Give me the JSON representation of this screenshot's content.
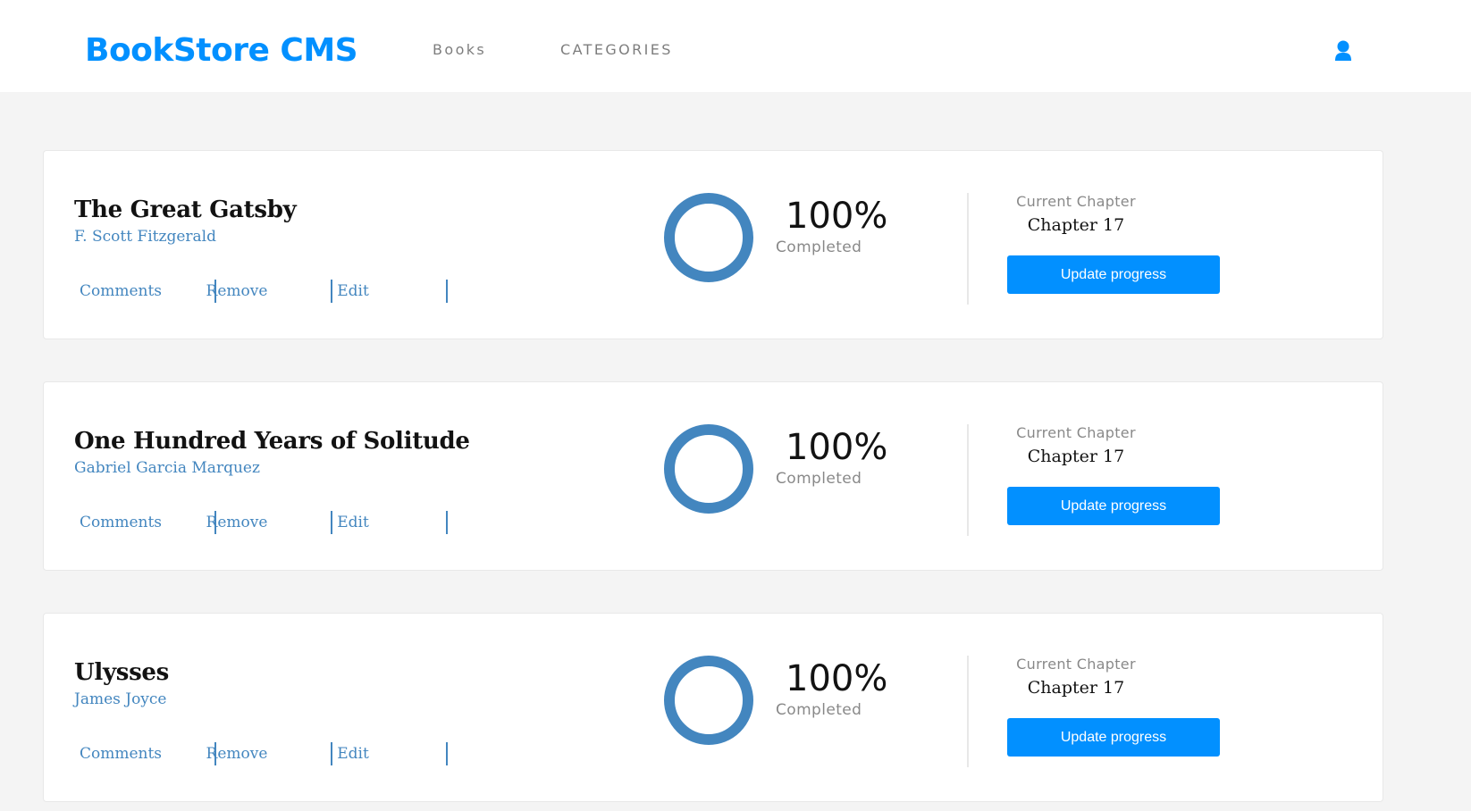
{
  "header": {
    "brand": "BookStore CMS",
    "nav": [
      {
        "label": "Books"
      },
      {
        "label": "CATEGORIES"
      }
    ],
    "user_icon": "user-icon"
  },
  "colors": {
    "brand": "#0290ff",
    "link": "#4386bf",
    "button": "#0290ff",
    "background": "#f4f4f4",
    "progress_ring": "#4386bf"
  },
  "books": [
    {
      "title": "The Great Gatsby",
      "author": "F. Scott Fitzgerald",
      "actions": [
        "Comments",
        "Remove",
        "Edit"
      ],
      "progress_percent": 100,
      "percent_text": "100%",
      "completed_label": "Completed",
      "current_chapter_label": "Current Chapter",
      "current_chapter": "Chapter 17",
      "update_button": "Update progress"
    },
    {
      "title": "One Hundred Years of Solitude",
      "author": "Gabriel Garcia Marquez",
      "actions": [
        "Comments",
        "Remove",
        "Edit"
      ],
      "progress_percent": 100,
      "percent_text": "100%",
      "completed_label": "Completed",
      "current_chapter_label": "Current Chapter",
      "current_chapter": "Chapter 17",
      "update_button": "Update progress"
    },
    {
      "title": "Ulysses",
      "author": "James Joyce",
      "actions": [
        "Comments",
        "Remove",
        "Edit"
      ],
      "progress_percent": 100,
      "percent_text": "100%",
      "completed_label": "Completed",
      "current_chapter_label": "Current Chapter",
      "current_chapter": "Chapter 17",
      "update_button": "Update progress"
    }
  ]
}
